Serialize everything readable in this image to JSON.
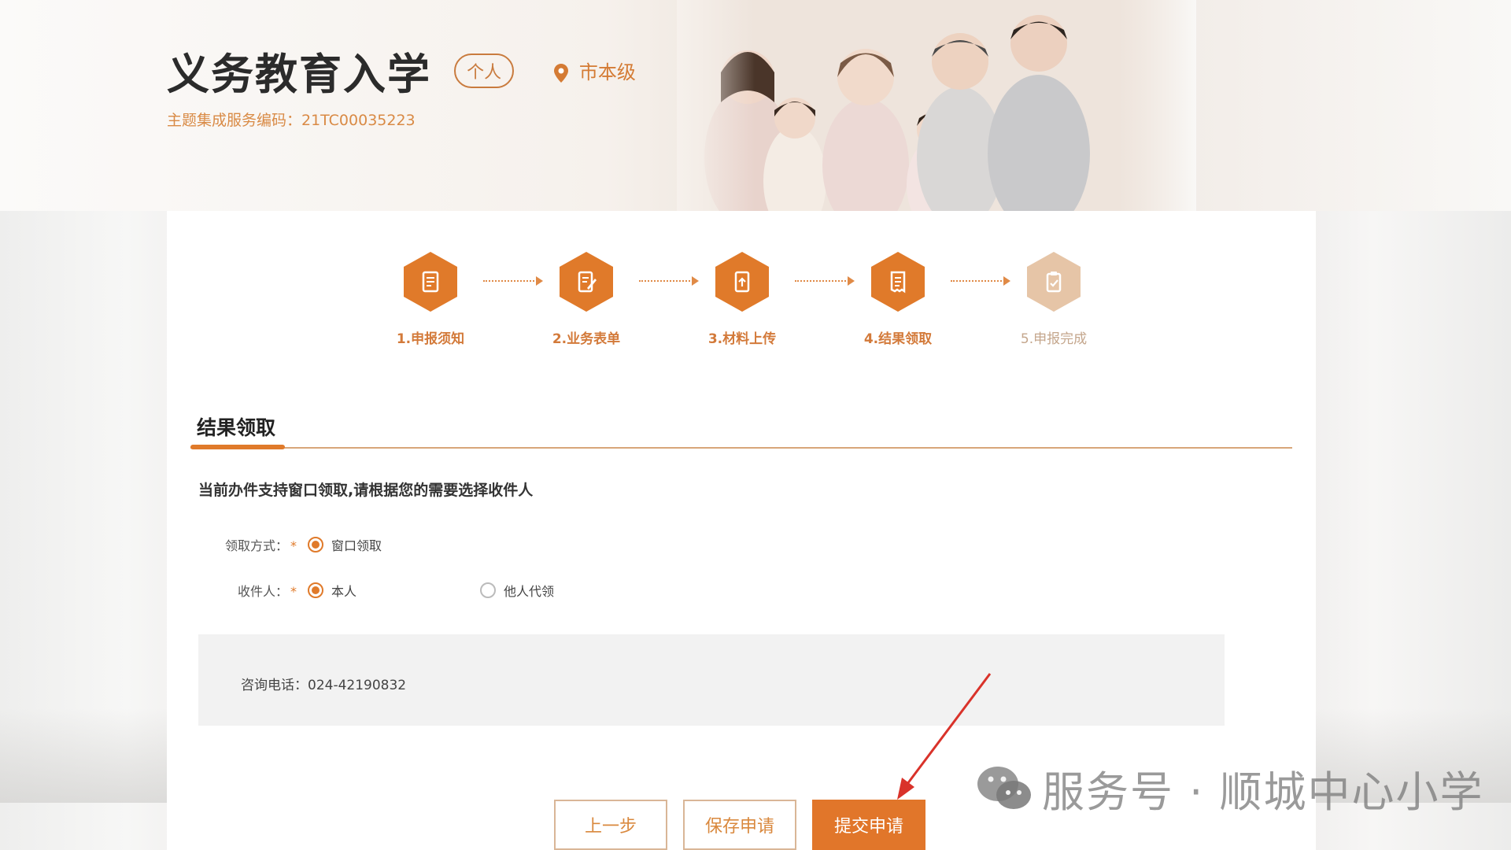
{
  "header": {
    "title": "义务教育入学",
    "tag": "个人",
    "location": "市本级",
    "service_code": "主题集成服务编码：21TC00035223"
  },
  "steps": [
    {
      "label": "1.申报须知",
      "icon": "notice-icon"
    },
    {
      "label": "2.业务表单",
      "icon": "form-icon"
    },
    {
      "label": "3.材料上传",
      "icon": "upload-icon"
    },
    {
      "label": "4.结果领取",
      "icon": "receipt-icon"
    },
    {
      "label": "5.申报完成",
      "icon": "complete-icon"
    }
  ],
  "section": {
    "title": "结果领取",
    "hint": "当前办件支持窗口领取,请根据您的需要选择收件人"
  },
  "form": {
    "pickup_label": "领取方式：",
    "pickup_option": "窗口领取",
    "recipient_label": "收件人：",
    "recipient_self": "本人",
    "recipient_other": "他人代领",
    "required_mark": "*"
  },
  "info": {
    "phone": "咨询电话：024-42190832"
  },
  "buttons": {
    "prev": "上一步",
    "save": "保存申请",
    "submit": "提交申请"
  },
  "watermark": "服务号 · 顺城中心小学",
  "colors": {
    "accent": "#e1762a",
    "accent_light": "#e6c5a7",
    "info_bg": "#f2f2f2"
  }
}
